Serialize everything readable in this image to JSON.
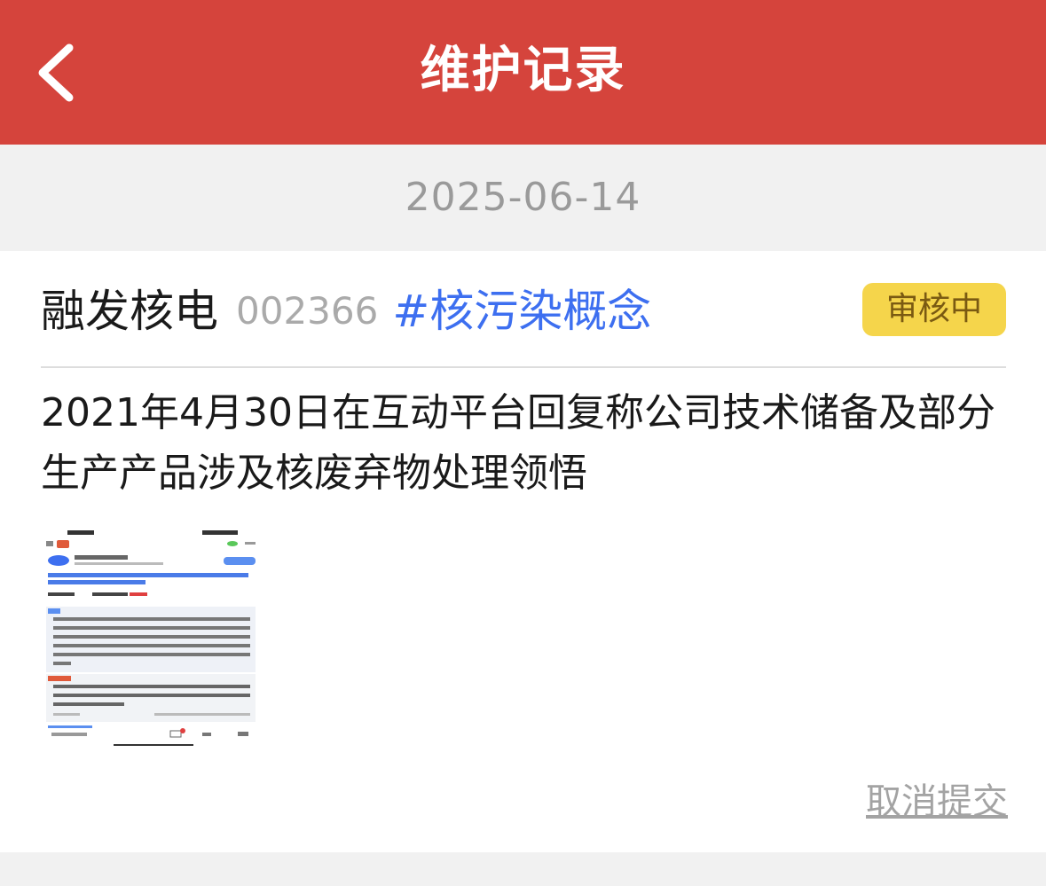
{
  "header": {
    "title": "维护记录",
    "back_icon": "chevron-left-icon"
  },
  "record": {
    "date": "2025-06-14",
    "stock_name": "融发核电",
    "stock_code": "002366",
    "tag": "#核污染概念",
    "status": "审核中",
    "content": "2021年4月30日在互动平台回复称公司技术储备及部分生产产品涉及核废弃物处理领悟",
    "cancel_label": "取消提交"
  },
  "colors": {
    "header_bg": "#d5443c",
    "tag_blue": "#3d6ff0",
    "badge_yellow": "#f5d54b",
    "page_bg": "#f1f1f1"
  }
}
